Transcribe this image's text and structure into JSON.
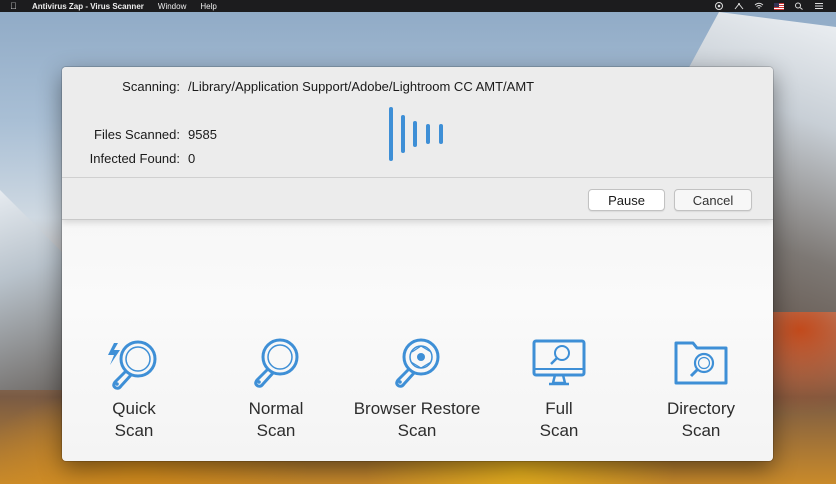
{
  "menubar": {
    "app_name": "Antivirus Zap - Virus Scanner",
    "items": [
      "Window",
      "Help"
    ]
  },
  "scan_status": {
    "scanning_label": "Scanning:",
    "scanning_path": "/Library/Application Support/Adobe/Lightroom CC AMT/AMT",
    "files_scanned_label": "Files Scanned:",
    "files_scanned_value": "9585",
    "infected_found_label": "Infected Found:",
    "infected_found_value": "0"
  },
  "buttons": {
    "pause": "Pause",
    "cancel": "Cancel"
  },
  "scan_options": [
    {
      "line1": "Quick",
      "line2": "Scan",
      "icon": "quick-scan-icon"
    },
    {
      "line1": "Normal",
      "line2": "Scan",
      "icon": "normal-scan-icon"
    },
    {
      "line1": "Browser Restore",
      "line2": "Scan",
      "icon": "browser-restore-scan-icon"
    },
    {
      "line1": "Full",
      "line2": "Scan",
      "icon": "full-scan-icon"
    },
    {
      "line1": "Directory",
      "line2": "Scan",
      "icon": "directory-scan-icon"
    }
  ],
  "colors": {
    "accent": "#3e8fd6",
    "menubar": "#1c1c1e",
    "sheet_bg": "#ececec"
  }
}
